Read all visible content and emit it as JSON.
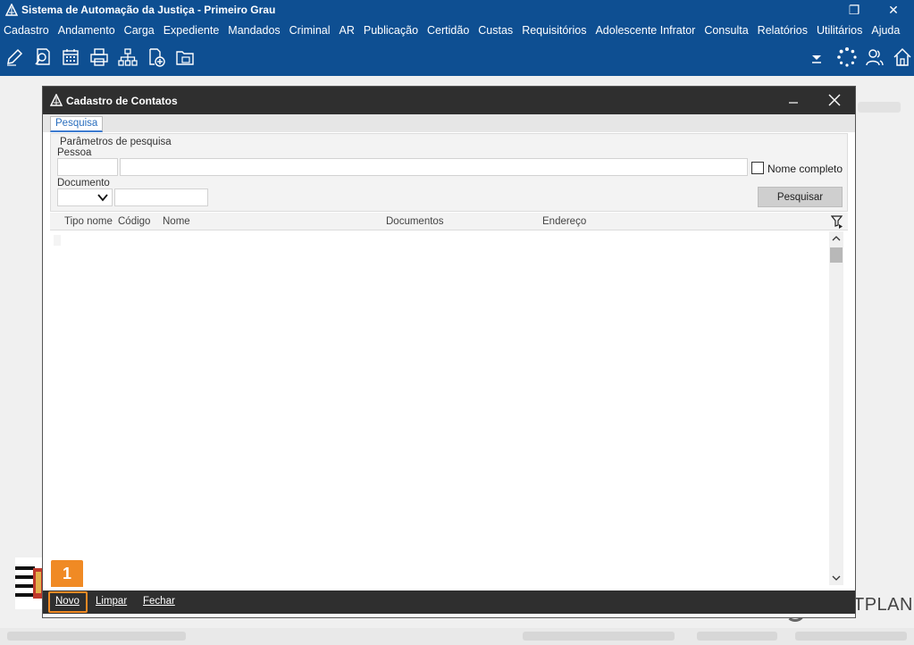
{
  "app": {
    "title": "Sistema de Automação da Justiça - Primeiro Grau",
    "menu": [
      "Cadastro",
      "Andamento",
      "Carga",
      "Expediente",
      "Mandados",
      "Criminal",
      "AR",
      "Publicação",
      "Certidão",
      "Custas",
      "Requisitórios",
      "Adolescente Infrator",
      "Consulta",
      "Relatórios",
      "Utilitários",
      "Ajuda"
    ],
    "window_controls": {
      "restore": "❐",
      "close": "✕"
    },
    "toolbar_icons": [
      "edit-icon",
      "search-document-icon",
      "calendar-icon",
      "print-icon",
      "org-tree-icon",
      "add-document-icon",
      "folder-icon",
      "dropdown-arrow-icon",
      "loading-icon",
      "users-icon",
      "home-icon"
    ],
    "brand_text": "TPLAN",
    "accent_color": "#0e4f92"
  },
  "dialog": {
    "title": "Cadastro de Contatos",
    "tab": "Pesquisa",
    "params_legend": "Parâmetros de pesquisa",
    "pessoa_label": "Pessoa",
    "pessoa_code_value": "",
    "pessoa_name_value": "",
    "nome_completo_label": "Nome completo",
    "nome_completo_checked": false,
    "documento_label": "Documento",
    "documento_type_value": "",
    "documento_value": "",
    "search_button": "Pesquisar",
    "columns": [
      "Tipo nome",
      "Código",
      "Nome",
      "Documentos",
      "Endereço"
    ],
    "rows": [],
    "footer": {
      "novo": "Novo",
      "limpar": "Limpar",
      "fechar": "Fechar"
    },
    "callout_number": "1",
    "callout_color": "#f08a24",
    "titlebar_color": "#2f2f2f"
  }
}
